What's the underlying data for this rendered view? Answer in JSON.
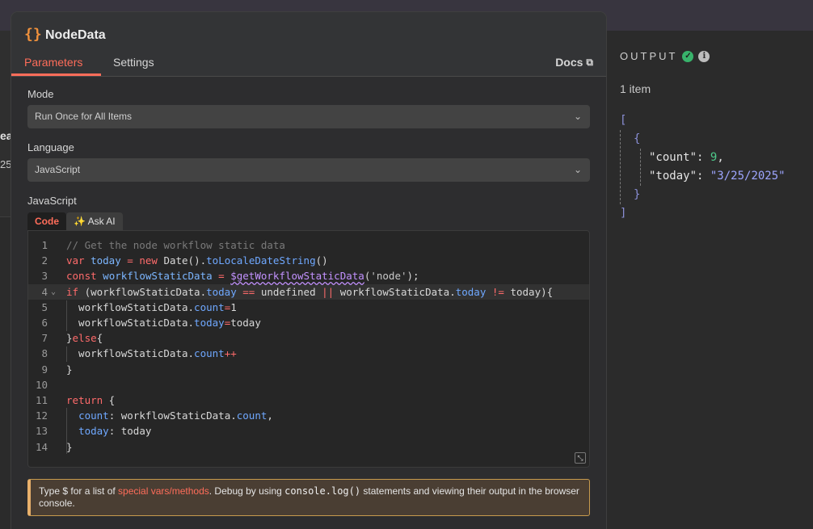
{
  "background": {
    "partial_title": "ea",
    "partial_text": "25"
  },
  "node": {
    "icon": "curly-braces-icon",
    "name": "NodeData",
    "tabs": {
      "parameters": "Parameters",
      "settings": "Settings"
    },
    "docs_label": "Docs"
  },
  "fields": {
    "mode_label": "Mode",
    "mode_value": "Run Once for All Items",
    "language_label": "Language",
    "language_value": "JavaScript",
    "code_label": "JavaScript"
  },
  "editor": {
    "tabs": {
      "code": "Code",
      "ask_ai": "✨ Ask AI"
    },
    "lines": [
      "// Get the node workflow static data",
      "var today = new Date().toLocaleDateString()",
      "const workflowStaticData = $getWorkflowStaticData('node');",
      "if (workflowStaticData.today == undefined || workflowStaticData.today != today){",
      "  workflowStaticData.count=1",
      "  workflowStaticData.today=today",
      "}else{",
      "  workflowStaticData.count++",
      "}",
      "",
      "return {",
      "  count: workflowStaticData.count,",
      "  today: today",
      "}"
    ],
    "active_line": 4
  },
  "hint": {
    "prefix": "Type $ for a list of ",
    "link": "special vars/methods",
    "middle": ". Debug by using ",
    "code": "console.log()",
    "suffix": " statements and viewing their output in the browser console."
  },
  "output": {
    "title": "OUTPUT",
    "count_label": "1 item",
    "json": {
      "count_key": "\"count\"",
      "count_value": "9",
      "today_key": "\"today\"",
      "today_value": "\"3/25/2025\""
    }
  },
  "colors": {
    "accent": "#ff6d5a",
    "success": "#38b36b",
    "warning_border": "#c79a4d"
  }
}
